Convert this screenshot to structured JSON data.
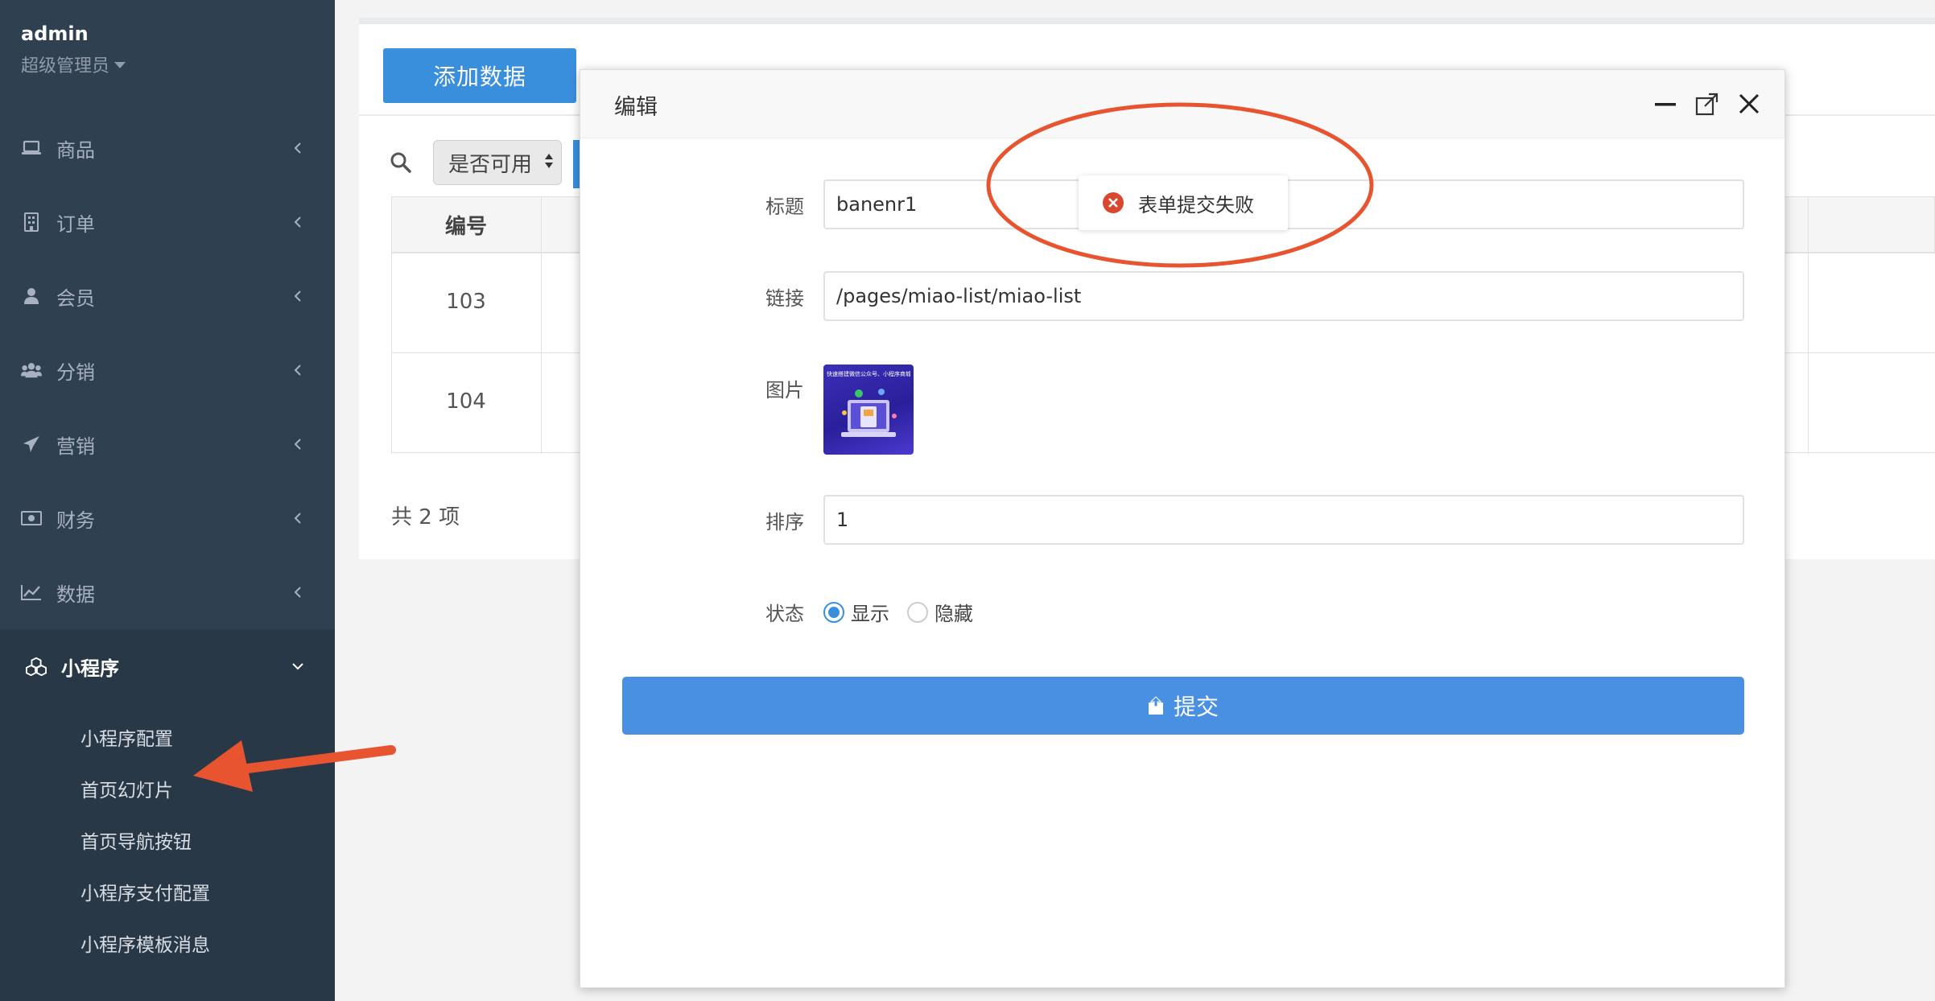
{
  "sidebar": {
    "user": "admin",
    "role": "超级管理员",
    "items": [
      {
        "label": "商品",
        "icon": "laptop-icon"
      },
      {
        "label": "订单",
        "icon": "building-icon"
      },
      {
        "label": "会员",
        "icon": "user-icon"
      },
      {
        "label": "分销",
        "icon": "users-icon"
      },
      {
        "label": "营销",
        "icon": "paper-plane-icon"
      },
      {
        "label": "财务",
        "icon": "money-icon"
      },
      {
        "label": "数据",
        "icon": "line-chart-icon"
      }
    ],
    "active_group": {
      "label": "小程序",
      "icon": "cubes-icon",
      "children": [
        "小程序配置",
        "首页幻灯片",
        "首页导航按钮",
        "小程序支付配置",
        "小程序模板消息"
      ]
    }
  },
  "main": {
    "add_button": "添加数据",
    "filter_select": "是否可用",
    "table": {
      "header_id": "编号",
      "rows": [
        {
          "id": "103"
        },
        {
          "id": "104"
        }
      ]
    },
    "total": "共 2 项"
  },
  "modal": {
    "title": "编辑",
    "fields": {
      "title_label": "标题",
      "title_value": "banenr1",
      "link_label": "链接",
      "link_value": "/pages/miao-list/miao-list",
      "image_label": "图片",
      "sort_label": "排序",
      "sort_value": "1",
      "status_label": "状态",
      "status_show": "显示",
      "status_hide": "隐藏",
      "status_selected": "显示"
    },
    "submit_label": "提交",
    "thumbnail_text": "快速搭建微信公众号、小程序商城"
  },
  "toast": {
    "message": "表单提交失败"
  },
  "annotations": {
    "color": "#e8542f"
  },
  "colors": {
    "sidebar_bg": "#2f4050",
    "primary": "#3a8fdc",
    "error": "#d9472f"
  }
}
